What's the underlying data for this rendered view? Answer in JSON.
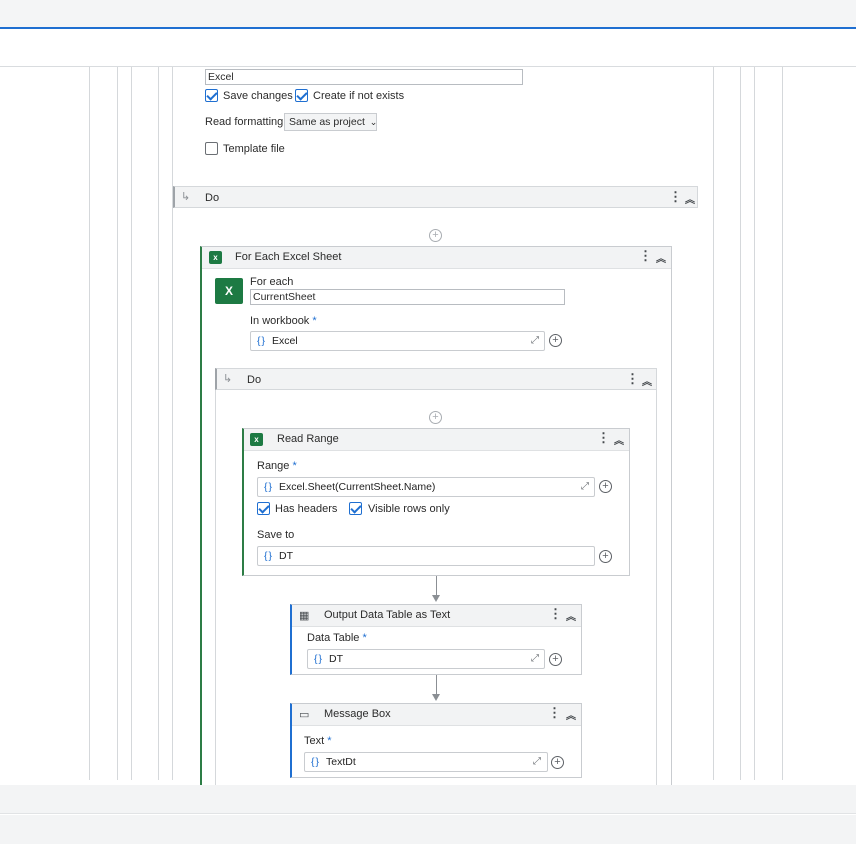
{
  "open_excel": {
    "file_value": "Excel",
    "save_changes_label": "Save changes",
    "create_if_not_exists_label": "Create if not exists",
    "read_formatting_label": "Read formatting",
    "read_formatting_value": "Same as project",
    "template_file_label": "Template file",
    "do_label": "Do"
  },
  "for_each_sheet": {
    "title": "For Each Excel Sheet",
    "for_each_label": "For each",
    "for_each_value": "CurrentSheet",
    "in_workbook_label": "In workbook",
    "in_workbook_value": "Excel",
    "do_label": "Do"
  },
  "read_range": {
    "title": "Read Range",
    "range_label": "Range",
    "range_value": "Excel.Sheet(CurrentSheet.Name)",
    "has_headers_label": "Has headers",
    "visible_rows_only_label": "Visible rows only",
    "save_to_label": "Save to",
    "save_to_value": "DT"
  },
  "output_dt": {
    "title": "Output Data Table as Text",
    "data_table_label": "Data Table",
    "data_table_value": "DT"
  },
  "message_box": {
    "title": "Message Box",
    "text_label": "Text",
    "text_value": "TextDt"
  },
  "common": {
    "required_mark": "*",
    "brace": "{}"
  },
  "colors": {
    "accent_blue": "#1f6fd1",
    "excel_green": "#1d7a43"
  }
}
